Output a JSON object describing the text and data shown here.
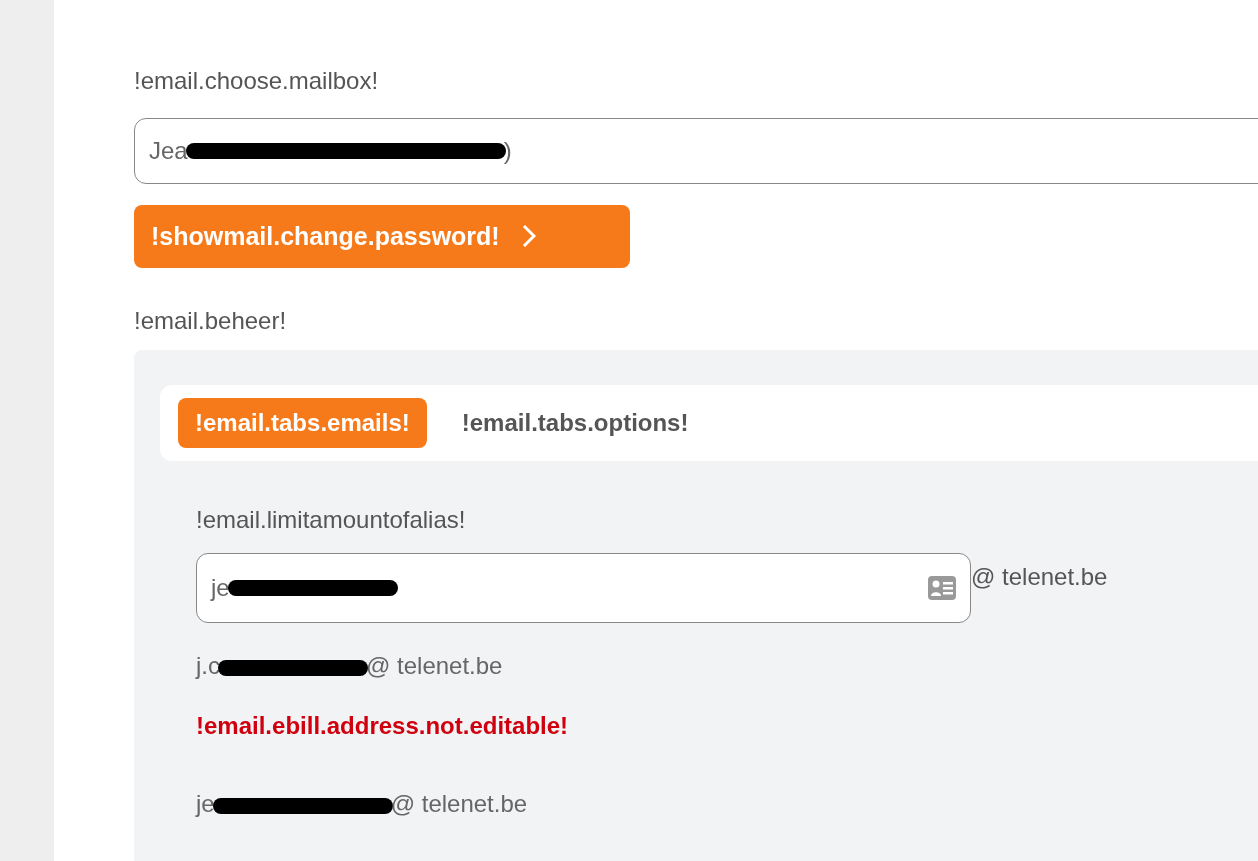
{
  "mailbox": {
    "label": "!email.choose.mailbox!",
    "value_start": "Jea",
    "value_end": ")"
  },
  "change_password": {
    "label": "!showmail.change.password!"
  },
  "management": {
    "label": "!email.beheer!",
    "tabs": [
      {
        "label": "!email.tabs.emails!",
        "selected": true
      },
      {
        "label": "!email.tabs.options!",
        "selected": false
      }
    ],
    "alias_limit": "!email.limitamountofalias!",
    "alias_input": {
      "value": "je",
      "domain": "@ telenet.be"
    },
    "addresses": [
      {
        "kind": "address",
        "start": "j.c",
        "end": "@ telenet.be"
      },
      {
        "kind": "error",
        "text": "!email.ebill.address.not.editable!"
      },
      {
        "kind": "address",
        "start": "je",
        "end": "@ telenet.be"
      }
    ]
  }
}
